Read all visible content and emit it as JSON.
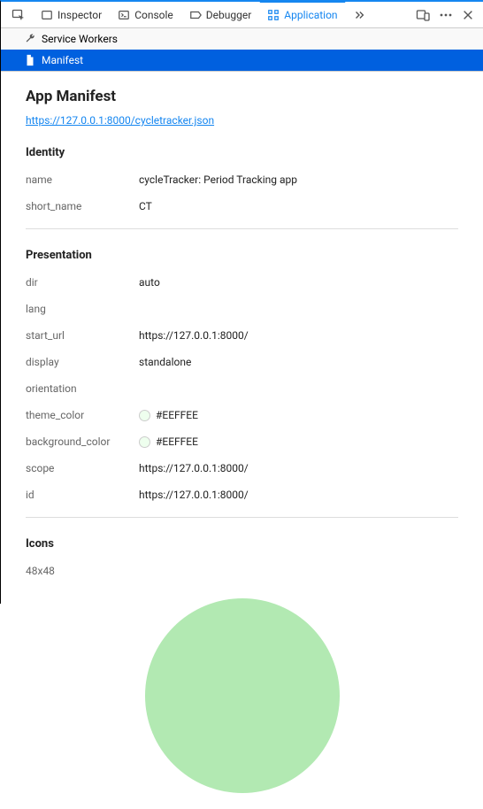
{
  "tabs": {
    "inspector": "Inspector",
    "console": "Console",
    "debugger": "Debugger",
    "application": "Application"
  },
  "sidebar": {
    "service_workers": "Service Workers",
    "manifest": "Manifest"
  },
  "manifest": {
    "title": "App Manifest",
    "url": "https://127.0.0.1:8000/cycletracker.json",
    "sections": {
      "identity_label": "Identity",
      "presentation_label": "Presentation",
      "icons_label": "Icons"
    },
    "identity": {
      "name_key": "name",
      "name_val": "cycleTracker: Period Tracking app",
      "short_name_key": "short_name",
      "short_name_val": "CT"
    },
    "presentation": {
      "dir_key": "dir",
      "dir_val": "auto",
      "lang_key": "lang",
      "lang_val": "",
      "start_url_key": "start_url",
      "start_url_val": "https://127.0.0.1:8000/",
      "display_key": "display",
      "display_val": "standalone",
      "orientation_key": "orientation",
      "orientation_val": "",
      "theme_color_key": "theme_color",
      "theme_color_val": "#EEFFEE",
      "background_color_key": "background_color",
      "background_color_val": "#EEFFEE",
      "scope_key": "scope",
      "scope_val": "https://127.0.0.1:8000/",
      "id_key": "id",
      "id_val": "https://127.0.0.1:8000/"
    },
    "icons": {
      "size_label": "48x48",
      "preview_color": "#b2e9b2"
    }
  }
}
